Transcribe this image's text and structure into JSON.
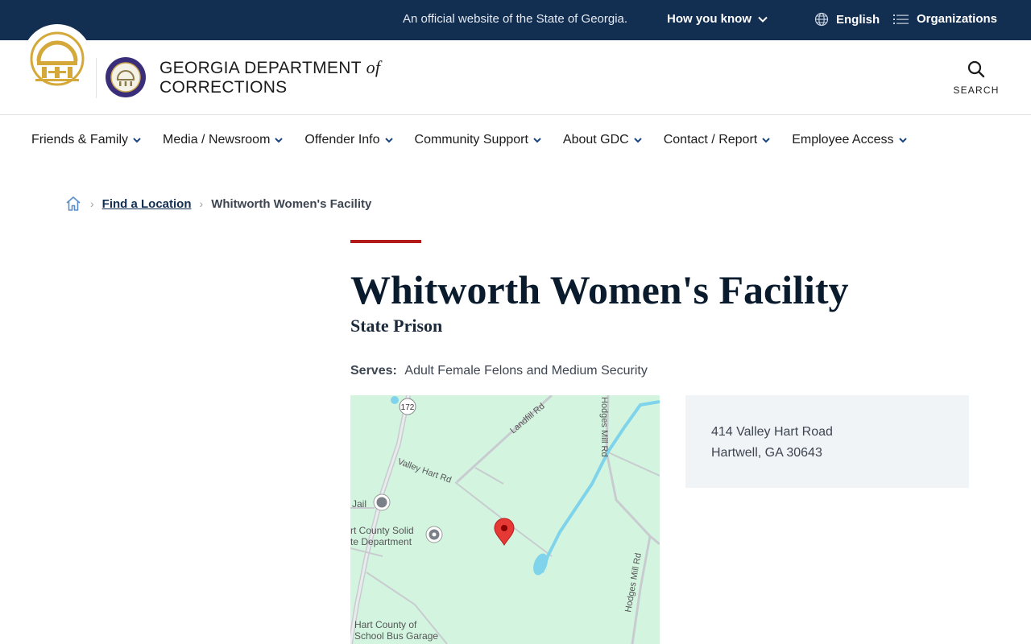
{
  "topbar": {
    "official_text": "An official website of the State of Georgia.",
    "how_you_know": "How you know",
    "language": "English",
    "organizations": "Organizations"
  },
  "header": {
    "dept_name_line1": "GEORGIA DEPARTMENT",
    "dept_name_of": "of",
    "dept_name_line2": "CORRECTIONS",
    "search_label": "SEARCH"
  },
  "nav": {
    "items": [
      {
        "label": "Friends & Family"
      },
      {
        "label": "Media / Newsroom"
      },
      {
        "label": "Offender Info"
      },
      {
        "label": "Community Support"
      },
      {
        "label": "About GDC"
      },
      {
        "label": "Contact / Report"
      },
      {
        "label": "Employee Access"
      }
    ]
  },
  "breadcrumb": {
    "parent": "Find a Location",
    "current": "Whitworth Women's Facility"
  },
  "facility": {
    "title": "Whitworth Women's Facility",
    "type": "State Prison",
    "serves_label": "Serves:",
    "serves_value": "Adult Female Felons and Medium Security"
  },
  "map": {
    "labels": {
      "route": "172",
      "landfill_rd": "Landfill Rd",
      "hodges_mill_rd_top": "Hodges Mill Rd",
      "valley_hart_rd": "Valley Hart Rd",
      "jail": "Jail",
      "solid_waste_1": "rt County Solid",
      "solid_waste_2": "te Department",
      "hodges_mill_rd_bottom": "Hodges Mill Rd",
      "bus_garage_1": "Hart County of",
      "bus_garage_2": "School Bus Garage"
    }
  },
  "address": {
    "line1": "414 Valley Hart Road",
    "line2": "Hartwell, GA 30643"
  },
  "colors": {
    "topbar_bg": "#122e51",
    "accent_red": "#b31b1b",
    "nav_chevron": "#1a4480",
    "map_bg": "#d3f5e0"
  }
}
